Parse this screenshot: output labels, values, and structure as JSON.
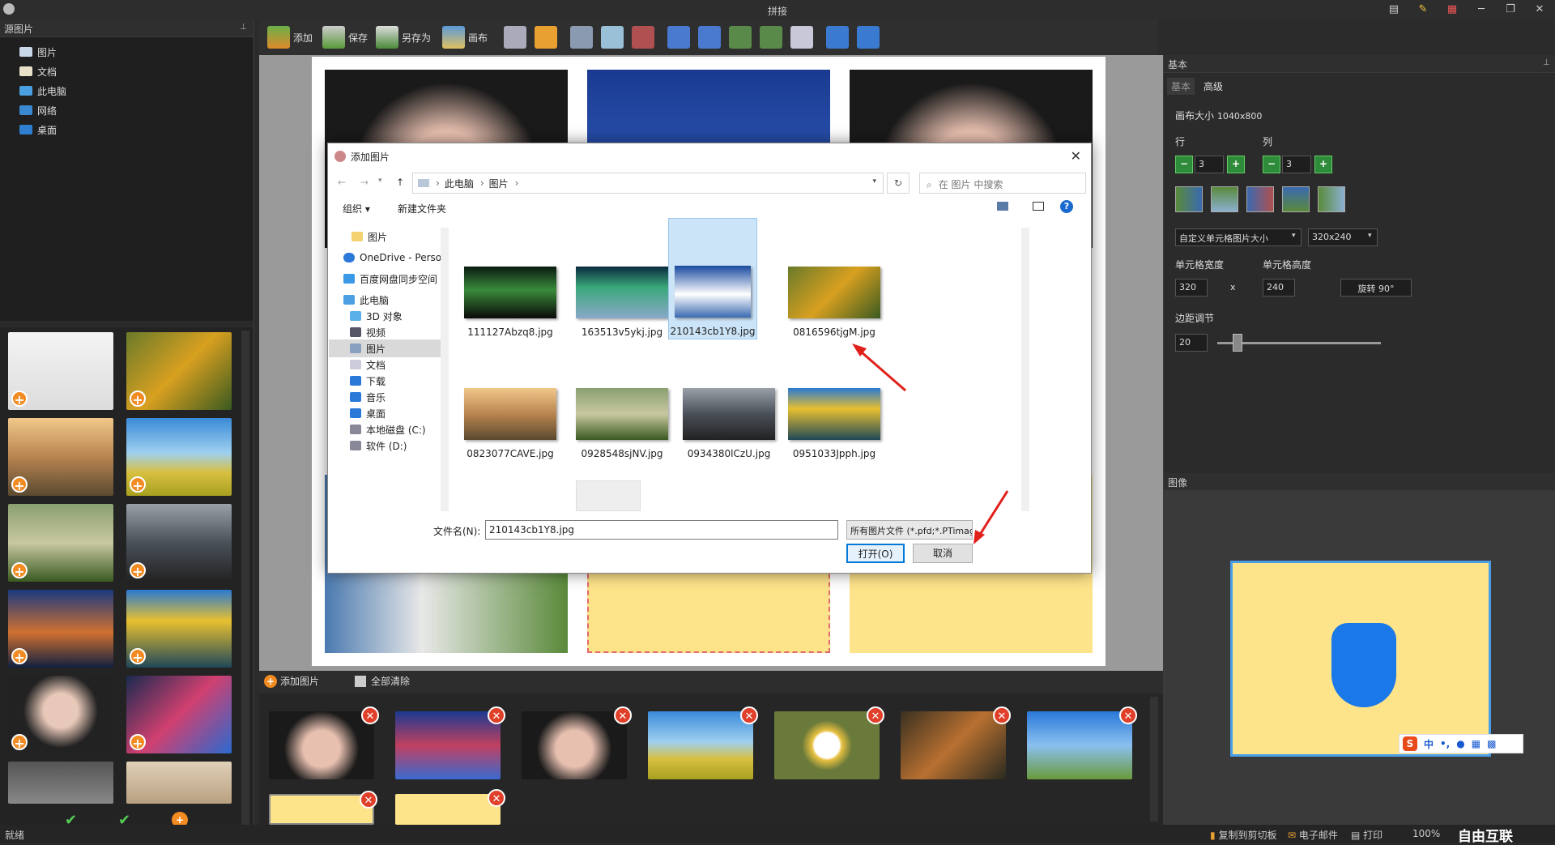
{
  "app": {
    "title": "拼接"
  },
  "toolbar": {
    "add": "添加",
    "save": "保存",
    "save_as": "另存为",
    "canvas": "画布"
  },
  "left": {
    "panel_title": "源图片",
    "tree": [
      "图片",
      "文档",
      "此电脑",
      "网络",
      "桌面"
    ]
  },
  "strip": {
    "add_label": "添加图片",
    "clear_label": "全部清除"
  },
  "right": {
    "panel_title": "基本",
    "tab_basic": "基本",
    "tab_advanced": "高级",
    "canvas_size_label": "画布大小",
    "canvas_size_value": "1040x800",
    "rows_label": "行",
    "cols_label": "列",
    "rows_value": "3",
    "cols_value": "3",
    "cell_mode": "自定义单元格图片大小",
    "cell_size": "320x240",
    "cell_width_label": "单元格宽度",
    "cell_height_label": "单元格高度",
    "cell_width": "320",
    "cell_height": "240",
    "x_sep": "x",
    "rotate_label": "旋转 90°",
    "margin_label": "边距调节",
    "margin_value": "20",
    "margin_fraction": 0.1,
    "image_panel_title": "图像"
  },
  "status": {
    "left": "就绪",
    "copy_clipboard": "复制到剪切板",
    "email": "电子邮件",
    "print": "打印",
    "zoom": "100%",
    "watermark": "自由互联"
  },
  "dialog": {
    "title": "添加图片",
    "breadcrumb_pc": "此电脑",
    "breadcrumb_pictures": "图片",
    "search_placeholder": "在 图片 中搜索",
    "organize": "组织 ▾",
    "new_folder": "新建文件夹",
    "nav_items": [
      "图片",
      "OneDrive - Perso",
      "百度网盘同步空间",
      "此电脑",
      "3D 对象",
      "视频",
      "图片",
      "文档",
      "下载",
      "音乐",
      "桌面",
      "本地磁盘 (C:)",
      "软件 (D:)"
    ],
    "files": [
      "111127Abzq8.jpg",
      "163513v5ykj.jpg",
      "210143cb1Y8.jpg",
      "0816596tjgM.jpg",
      "0823077CAVE.jpg",
      "0928548sjNV.jpg",
      "0934380lCzU.jpg",
      "0951033Jpph.jpg"
    ],
    "filename_label": "文件名(N):",
    "filename_value": "210143cb1Y8.jpg",
    "filetype": "所有图片文件 (*.pfd;*.PTimag",
    "open": "打开(O)",
    "cancel": "取消"
  },
  "ime": {
    "lang": "中"
  }
}
